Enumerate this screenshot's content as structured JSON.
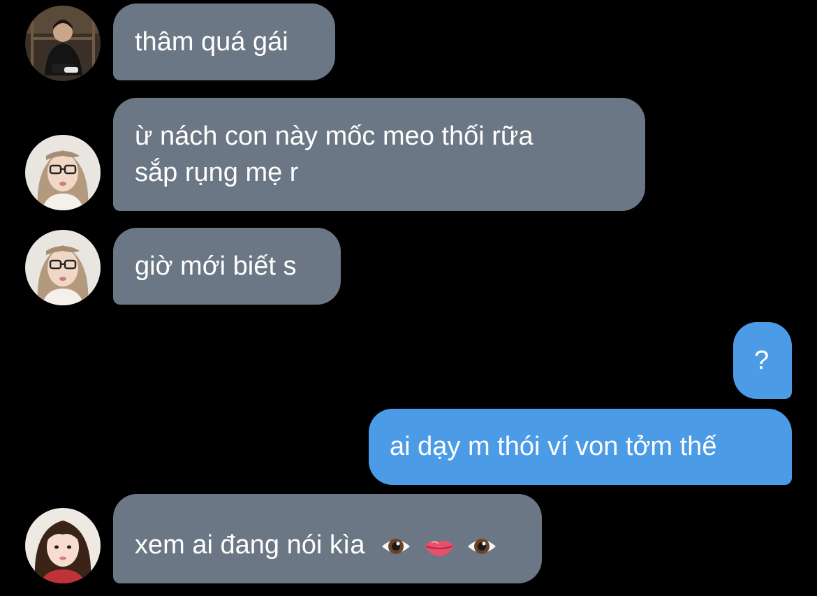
{
  "conversation": {
    "messages": [
      {
        "sender": "incoming",
        "lines": [
          "thâm quá gái"
        ]
      },
      {
        "sender": "incoming",
        "lines": [
          "ừ nách con này mốc meo thối rữa",
          "sắp rụng mẹ r"
        ]
      },
      {
        "sender": "incoming",
        "lines": [
          "giờ mới biết s"
        ]
      },
      {
        "sender": "outgoing",
        "lines": [
          "?"
        ]
      },
      {
        "sender": "outgoing",
        "lines": [
          "ai dạy m thói ví von tởm thế"
        ]
      },
      {
        "sender": "incoming",
        "lines": [
          "xem ai đang nói kìa"
        ],
        "emojis": [
          "eye-emoji",
          "lips-emoji",
          "eye-emoji"
        ]
      }
    ]
  },
  "colors": {
    "background": "#000000",
    "incoming_bubble": "#6b7785",
    "outgoing_bubble": "#4b9be6",
    "text": "#ffffff"
  },
  "icons": {
    "avatars": [
      "contact-avatar-1",
      "contact-avatar-2",
      "contact-avatar-2",
      "contact-avatar-3"
    ]
  }
}
